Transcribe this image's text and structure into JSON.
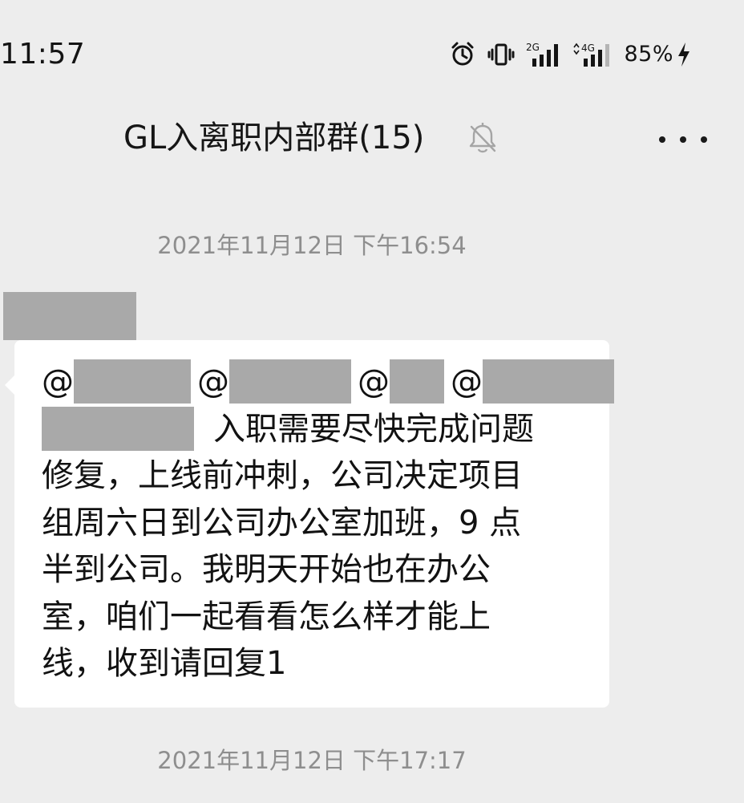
{
  "status_bar": {
    "time": "11:57",
    "icons": [
      "alarm-icon",
      "vibrate-icon",
      "signal-2g-icon",
      "signal-4g-icon",
      "battery-charging-icon"
    ],
    "network_labels": [
      "2G",
      "4G"
    ],
    "battery": "85%"
  },
  "nav": {
    "title": "GL入离职内部群(15)",
    "icons": [
      "mute-bell-icon",
      "more-icon"
    ]
  },
  "chat": {
    "messages": [
      {
        "timestamp": "2021年11月12日 下午16:54",
        "sender": "[redacted]",
        "mentions": [
          "@",
          "@",
          "@",
          "@"
        ],
        "lines": [
          "入职需要尽快完成问题",
          "修复，上线前冲刺，公司决定项目",
          "组周六日到公司办公室加班，9 点",
          "半到公司。我明天开始也在办公",
          "室，咱们一起看看怎么样才能上",
          "线，收到请回复1"
        ]
      },
      {
        "timestamp": "2021年11月12日 下午17:17"
      }
    ]
  },
  "colors": {
    "background": "#ededed",
    "bubble": "#ffffff",
    "redaction": "#a9a9a9",
    "timestamp": "#8e8e8e"
  }
}
